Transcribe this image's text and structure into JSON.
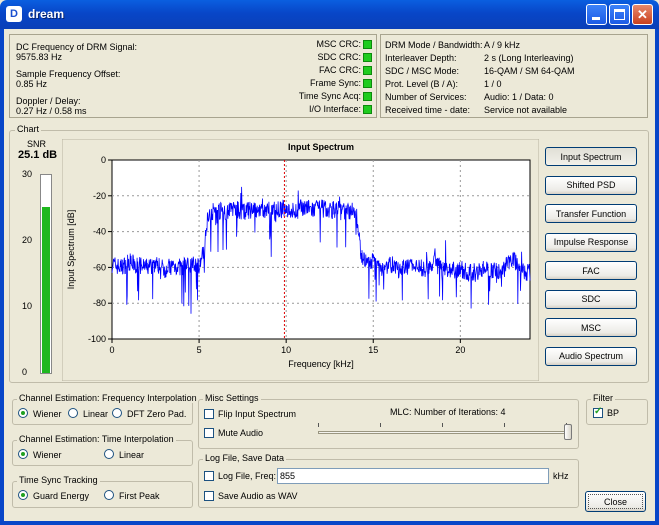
{
  "window": {
    "title": "dream",
    "app_icon": "D"
  },
  "status_left": [
    {
      "label": "DC Frequency of DRM Signal:",
      "value": "9575.83 Hz"
    },
    {
      "label": "Sample Frequency Offset:",
      "value": "0.85 Hz"
    },
    {
      "label": "Doppler / Delay:",
      "value": "0.27 Hz / 0.58 ms"
    }
  ],
  "crc": [
    {
      "label": "MSC CRC:",
      "color": "#1fcc1f"
    },
    {
      "label": "SDC CRC:",
      "color": "#1fcc1f"
    },
    {
      "label": "FAC CRC:",
      "color": "#1fcc1f"
    },
    {
      "label": "Frame Sync:",
      "color": "#1fcc1f"
    },
    {
      "label": "Time Sync Acq:",
      "color": "#1fcc1f"
    },
    {
      "label": "I/O Interface:",
      "color": "#1fcc1f"
    }
  ],
  "info": [
    {
      "label": "DRM Mode / Bandwidth:",
      "value": "A / 9 kHz"
    },
    {
      "label": "Interleaver Depth:",
      "value": "2 s (Long Interleaving)"
    },
    {
      "label": "SDC / MSC Mode:",
      "value": "16-QAM / SM 64-QAM"
    },
    {
      "label": "Prot. Level (B / A):",
      "value": "1 / 0"
    },
    {
      "label": "Number of Services:",
      "value": "Audio: 1 / Data: 0"
    },
    {
      "label": "Received time - date:",
      "value": "Service not available"
    }
  ],
  "chart_group_label": "Chart",
  "snr": {
    "label": "SNR",
    "value_text": "25.1 dB",
    "value": 25.1,
    "max": 30,
    "ticks": [
      "30",
      "20",
      "10",
      "0"
    ]
  },
  "chart_data": {
    "type": "line",
    "title": "Input Spectrum",
    "xlabel": "Frequency [kHz]",
    "ylabel": "Input Spectrum [dB]",
    "xlim": [
      0,
      24
    ],
    "ylim": [
      -100,
      0
    ],
    "xticks": [
      "0",
      "5",
      "10",
      "15",
      "20"
    ],
    "yticks": [
      "0",
      "-20",
      "-40",
      "-60",
      "-80",
      "-100"
    ],
    "grid": true,
    "marker_x": 9.9,
    "series": [
      {
        "color": "#0000ff",
        "x": [
          0,
          0.5,
          1,
          1.5,
          2,
          2.5,
          3,
          3.5,
          4,
          4.5,
          5,
          5.3,
          5.5,
          6,
          6.5,
          7,
          7.5,
          8,
          8.5,
          9,
          9.5,
          10,
          10.5,
          11,
          11.5,
          12,
          12.5,
          13,
          13.5,
          14,
          14.3,
          14.6,
          15,
          15.5,
          16,
          16.5,
          17,
          17.5,
          18,
          18.5,
          19,
          19.5,
          20,
          20.5,
          21,
          21.5,
          22,
          22.5,
          23,
          23.5,
          24
        ],
        "y": [
          -58,
          -60,
          -57,
          -59,
          -60,
          -58,
          -61,
          -59,
          -60,
          -58,
          -59,
          -50,
          -30,
          -28,
          -29,
          -27,
          -29,
          -28,
          -30,
          -27,
          -28,
          -27,
          -29,
          -26,
          -28,
          -27,
          -28,
          -27,
          -29,
          -28,
          -52,
          -58,
          -57,
          -60,
          -58,
          -62,
          -59,
          -60,
          -61,
          -58,
          -60,
          -62,
          -61,
          -63,
          -62,
          -60,
          -62,
          -61,
          -54,
          -62,
          -63
        ]
      }
    ]
  },
  "view_buttons": [
    "Input Spectrum",
    "Shifted PSD",
    "Transfer Function",
    "Impulse Response",
    "FAC",
    "SDC",
    "MSC",
    "Audio Spectrum"
  ],
  "freq_interp": {
    "label": "Channel Estimation: Frequency Interpolation",
    "options": [
      "Wiener",
      "Linear",
      "DFT Zero Pad."
    ],
    "selected": 0
  },
  "time_interp": {
    "label": "Channel Estimation: Time Interpolation",
    "options": [
      "Wiener",
      "Linear"
    ],
    "selected": 0
  },
  "time_sync": {
    "label": "Time Sync Tracking",
    "options": [
      "Guard Energy",
      "First Peak"
    ],
    "selected": 0
  },
  "misc": {
    "label": "Misc Settings",
    "flip_label": "Flip Input Spectrum",
    "mute_label": "Mute Audio",
    "mlc_label": "MLC: Number of Iterations: 4",
    "mlc_value": 4,
    "mlc_max": 4
  },
  "filter": {
    "label": "Filter",
    "bp_label": "BP",
    "bp_checked": true
  },
  "logfile": {
    "label": "Log File, Save Data",
    "log_label": "Log File, Freq:",
    "freq_value": "855",
    "unit": "kHz",
    "save_label": "Save Audio as WAV"
  },
  "close_label": "Close"
}
